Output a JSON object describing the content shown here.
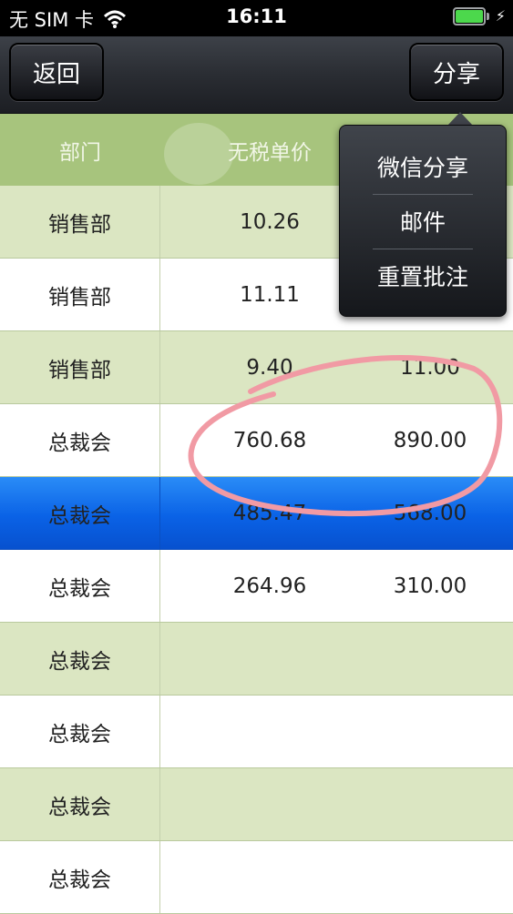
{
  "status_bar": {
    "carrier": "无 SIM 卡",
    "time": "16:11",
    "wifi_icon": "wifi-icon",
    "battery_icon": "battery-icon",
    "charging_icon": "charging-bolt-icon",
    "battery_level": 1.0
  },
  "nav": {
    "back_label": "返回",
    "share_label": "分享"
  },
  "table": {
    "headers": {
      "dept": "部门",
      "price": "无税单价"
    },
    "rows": [
      {
        "dept": "销售部",
        "price": "10.26",
        "total": ""
      },
      {
        "dept": "销售部",
        "price": "11.11",
        "total": ""
      },
      {
        "dept": "销售部",
        "price": "9.40",
        "total": "11.00"
      },
      {
        "dept": "总裁会",
        "price": "760.68",
        "total": "890.00"
      },
      {
        "dept": "总裁会",
        "price": "485.47",
        "total": "568.00"
      },
      {
        "dept": "总裁会",
        "price": "264.96",
        "total": "310.00"
      },
      {
        "dept": "总裁会",
        "price": "",
        "total": ""
      },
      {
        "dept": "总裁会",
        "price": "",
        "total": ""
      },
      {
        "dept": "总裁会",
        "price": "",
        "total": ""
      },
      {
        "dept": "总裁会",
        "price": "",
        "total": ""
      }
    ]
  },
  "share_menu": {
    "items": [
      "微信分享",
      "邮件",
      "重置批注"
    ]
  },
  "colors": {
    "header_green": "#a7c47d",
    "row_green": "#dbe6c2",
    "selected_blue": "#0a62e6",
    "annotation_pink": "#f19aa4"
  }
}
